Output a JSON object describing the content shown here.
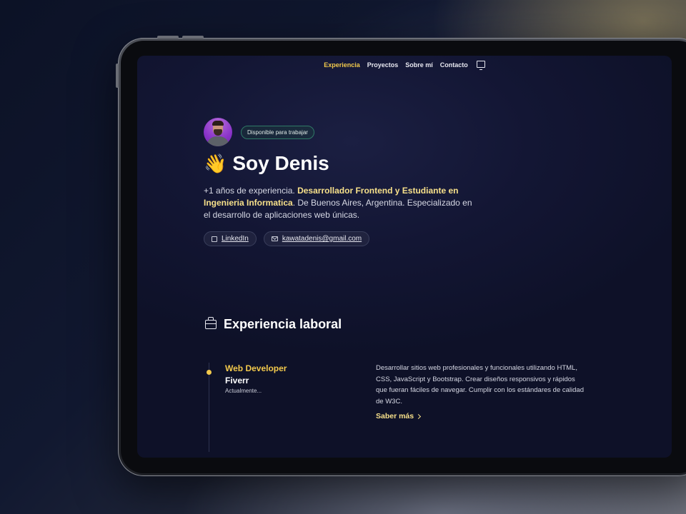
{
  "nav": {
    "items": [
      "Experiencia",
      "Proyectos",
      "Sobre mí",
      "Contacto"
    ],
    "active": "Experiencia"
  },
  "hero": {
    "badge": "Disponible para trabajar",
    "wave_emoji": "👋",
    "title": "Soy Denis",
    "desc_prefix": "+1 años de experiencia. ",
    "desc_highlight": "Desarrollador Frontend y Estudiante en Ingenieria Informatica",
    "desc_suffix": ". De Buenos Aires, Argentina. Especializado en el desarrollo de aplicaciones web únicas.",
    "linkedin_label": "LinkedIn",
    "email_label": "kawatadenis@gmail.com"
  },
  "experience": {
    "heading": "Experiencia laboral",
    "jobs": [
      {
        "role": "Web Developer",
        "company": "Fiverr",
        "date": "Actualmente...",
        "description": "Desarrollar sitios web profesionales y funcionales utilizando HTML, CSS, JavaScript y Bootstrap. Crear diseños responsivos y rápidos que fueran fáciles de navegar. Cumplir con los estándares de calidad de W3C.",
        "more_label": "Saber más"
      }
    ]
  },
  "icons": {
    "theme_toggle": "monitor-icon",
    "linkedin": "linkedin-icon",
    "email": "mail-icon",
    "experience": "briefcase-icon",
    "more": "chevron-right-icon"
  },
  "colors": {
    "accent": "#f2c94c",
    "highlight": "#f7e08a",
    "badge_border": "#2f7a66",
    "screen_bg": "#131634"
  }
}
